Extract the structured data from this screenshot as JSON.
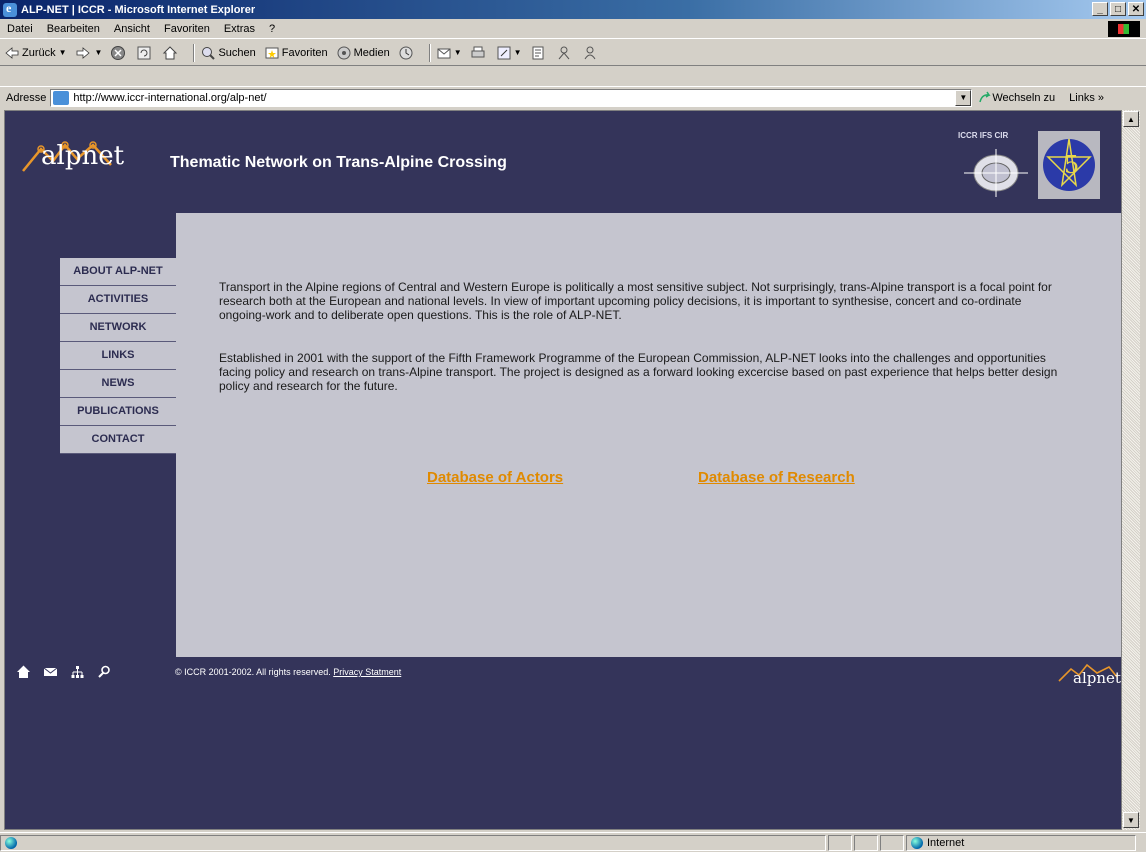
{
  "window": {
    "title": "ALP-NET | ICCR - Microsoft Internet Explorer",
    "controls": [
      "_",
      "□",
      "✕"
    ]
  },
  "menu": [
    "Datei",
    "Bearbeiten",
    "Ansicht",
    "Favoriten",
    "Extras",
    "?"
  ],
  "toolbar": {
    "back": "Zurück",
    "search": "Suchen",
    "favorites": "Favoriten",
    "media": "Medien"
  },
  "address": {
    "label": "Adresse",
    "url": "http://www.iccr-international.org/alp-net/",
    "go": "Wechseln zu",
    "links": "Links"
  },
  "page": {
    "logo_text": "alpnet",
    "site_title": "Thematic Network on Trans-Alpine Crossing",
    "partner_label": "ICCR IFS CIR",
    "nav": [
      "ABOUT ALP-NET",
      "ACTIVITIES",
      "NETWORK",
      "LINKS",
      "NEWS",
      "PUBLICATIONS",
      "CONTACT"
    ],
    "para1": "Transport in the Alpine regions of Central and Western Europe is politically a most sensitive subject.  Not surprisingly, trans-Alpine transport is a focal point for research both at the European and national levels. In view of important upcoming policy decisions, it is important to synthesise, concert and co-ordinate ongoing-work and to deliberate open questions. This is the role of ALP-NET.",
    "para2": "Established in 2001 with the support of  the Fifth Framework Programme of the European Commission, ALP-NET looks into the challenges and opportunities facing policy and research on trans-Alpine transport. The project is designed as a forward looking excercise based on past experience that helps better design policy and research for the future.",
    "link_actors": "Database of Actors",
    "link_research": "Database of Research",
    "copyright": "© ICCR 2001-2002. All rights reserved.",
    "privacy": "Privacy Statment",
    "small_logo_text": "alpnet"
  },
  "status": {
    "zone": "Internet"
  },
  "colors": {
    "page_bg": "#34345a",
    "content_bg": "#c5c5cf",
    "link": "#e08a00",
    "logo_orange": "#e8962a"
  }
}
